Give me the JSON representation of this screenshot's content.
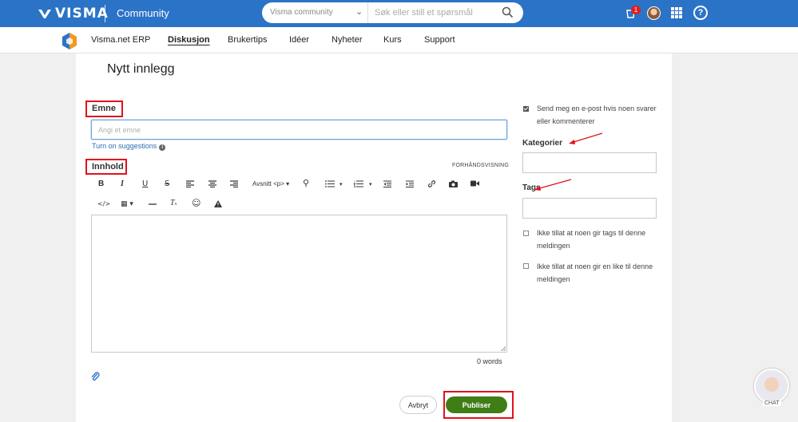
{
  "header": {
    "logo_text": "VISMA",
    "community_label": "Community",
    "search_scope": "Visma community",
    "search_placeholder": "Søk eller still et spørsmål",
    "notification_count": "1",
    "help_glyph": "?"
  },
  "nav": {
    "items": [
      {
        "label": "Visma.net ERP",
        "active": false
      },
      {
        "label": "Diskusjon",
        "active": true
      },
      {
        "label": "Brukertips",
        "active": false
      },
      {
        "label": "Idéer",
        "active": false
      },
      {
        "label": "Nyheter",
        "active": false
      },
      {
        "label": "Kurs",
        "active": false
      },
      {
        "label": "Support",
        "active": false
      }
    ]
  },
  "form": {
    "page_title": "Nytt innlegg",
    "subject_label": "Emne",
    "subject_placeholder": "Angi et emne",
    "suggestions_link": "Turn on suggestions",
    "content_label": "Innhold",
    "preview_link": "FORHÅNDSVISNING",
    "paragraph_format": "Avsnitt <p>",
    "word_count": "0 words",
    "cancel_label": "Avbryt",
    "publish_label": "Publiser"
  },
  "toolbar_icons": [
    "bold-icon",
    "italic-icon",
    "underline-icon",
    "strikethrough-icon",
    "align-left-icon",
    "align-center-icon",
    "align-right-icon",
    "paragraph-format-dropdown",
    "find-icon",
    "bullet-list-icon",
    "numbered-list-icon",
    "outdent-icon",
    "indent-icon",
    "link-icon",
    "image-icon",
    "video-icon",
    "code-icon",
    "table-icon",
    "horizontal-rule-icon",
    "clear-format-icon",
    "emoji-icon",
    "spoiler-icon"
  ],
  "sidebar": {
    "email_notify": {
      "label": "Send meg en e-post hvis noen svarer eller kommenterer",
      "checked": true
    },
    "categories_label": "Kategorier",
    "tags_label": "Tags",
    "no_tags": {
      "label": "Ikke tillat at noen gir tags til denne meldingen",
      "checked": false
    },
    "no_likes": {
      "label": "Ikke tillat at noen gir en like til denne meldingen",
      "checked": false
    }
  },
  "chat": {
    "label": "CHAT"
  },
  "colors": {
    "header_blue": "#2b73c7",
    "publish_green": "#3f7d16",
    "annotation_red": "#e0121b",
    "link_blue": "#2b6fb3"
  }
}
